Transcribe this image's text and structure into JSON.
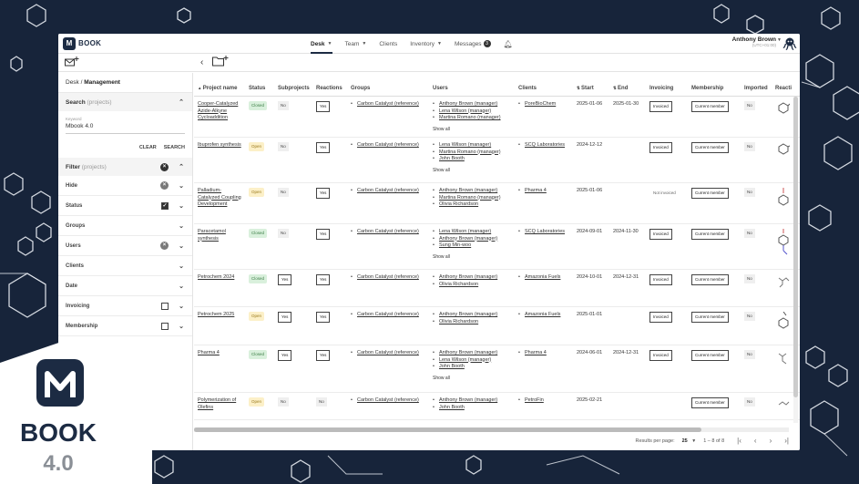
{
  "brand": {
    "name": "BOOK",
    "logo_letter": "M",
    "badge_name": "BOOK",
    "badge_version": "4.0"
  },
  "nav": [
    {
      "label": "Desk",
      "active": true,
      "caret": true
    },
    {
      "label": "Team",
      "caret": true
    },
    {
      "label": "Clients"
    },
    {
      "label": "Inventory",
      "caret": true
    },
    {
      "label": "Messages",
      "badge": "3"
    }
  ],
  "user": {
    "name": "Anthony Brown",
    "sub": "(UTC+01:00)"
  },
  "breadcrumb": {
    "root": "Desk / ",
    "current": "Management"
  },
  "search": {
    "title": "Search",
    "scope": "(projects)",
    "keyword_label": "Keyword",
    "keyword_value": "Mbook 4.0",
    "clear": "CLEAR",
    "submit": "SEARCH"
  },
  "filter": {
    "title": "Filter",
    "scope": "(projects)",
    "rows": [
      {
        "label": "Hide",
        "control": "clear"
      },
      {
        "label": "Status",
        "control": "checkbox-checked"
      },
      {
        "label": "Groups",
        "control": "none"
      },
      {
        "label": "Users",
        "control": "clear"
      },
      {
        "label": "Clients",
        "control": "none"
      },
      {
        "label": "Date",
        "control": "none"
      },
      {
        "label": "Invoicing",
        "control": "checkbox"
      },
      {
        "label": "Membership",
        "control": "checkbox"
      }
    ]
  },
  "table": {
    "columns": [
      "Project name",
      "Status",
      "Subprojects",
      "Reactions",
      "Groups",
      "Users",
      "Clients",
      "Start",
      "End",
      "Invoicing",
      "Membership",
      "Imported",
      "Reacti"
    ],
    "show_all": "Show all",
    "rows": [
      {
        "name": "Cooper-Catalyzed Azide-Alkyne Cycloaddition",
        "status": "Closed",
        "sub": "No",
        "react": "Yes",
        "group": "Carbon Catalyst (reference)",
        "users": [
          "Anthony Brown (manager)",
          "Lena Wilson (manager)",
          "Martina Romano (manager)"
        ],
        "show_all": true,
        "client": "PoreBioChem",
        "start": "2025-01-06",
        "end": "2025-01-30",
        "invoicing": "Invoiced",
        "membership": "Current member",
        "imported": "No"
      },
      {
        "name": "Ibuprofen synthesis",
        "status": "Open",
        "sub": "No",
        "react": "Yes",
        "group": "Carbon Catalyst (reference)",
        "users": [
          "Lena Wilson (manager)",
          "Martina Romano (manager)",
          "John Booth"
        ],
        "show_all": true,
        "client": "SCQ Laboratories",
        "start": "2024-12-12",
        "end": "",
        "invoicing": "Invoiced",
        "membership": "Current member",
        "imported": "No"
      },
      {
        "name": "Palladium-Catalyzed Coupling Development",
        "status": "Open",
        "sub": "No",
        "react": "Yes",
        "group": "Carbon Catalyst (reference)",
        "users": [
          "Anthony Brown (manager)",
          "Martina Romano (manager)",
          "Olivia Richardson"
        ],
        "show_all": false,
        "client": "Pharma 4",
        "start": "2025-01-06",
        "end": "",
        "invoicing": "Not invoiced",
        "membership": "Current member",
        "imported": "No"
      },
      {
        "name": "Paracetamol synthesis",
        "status": "Closed",
        "sub": "No",
        "react": "Yes",
        "group": "Carbon Catalyst (reference)",
        "users": [
          "Lena Wilson (manager)",
          "Anthony Brown (manager)",
          "Sung Min-woo"
        ],
        "show_all": true,
        "client": "SCQ Laboratories",
        "start": "2024-09-01",
        "end": "2024-11-30",
        "invoicing": "Invoiced",
        "membership": "Current member",
        "imported": "No"
      },
      {
        "name": "Petrochem 2024",
        "status": "Closed",
        "sub": "Yes",
        "react": "Yes",
        "group": "Carbon Catalyst (reference)",
        "users": [
          "Anthony Brown (manager)",
          "Olivia Richardson"
        ],
        "show_all": false,
        "client": "Amazonia Fuels",
        "start": "2024-10-01",
        "end": "2024-12-31",
        "invoicing": "Invoiced",
        "membership": "Current member",
        "imported": "No"
      },
      {
        "name": "Petrochem 2025",
        "status": "Open",
        "sub": "Yes",
        "react": "Yes",
        "group": "Carbon Catalyst (reference)",
        "users": [
          "Anthony Brown (manager)",
          "Olivia Richardson"
        ],
        "show_all": false,
        "client": "Amazonia Fuels",
        "start": "2025-01-01",
        "end": "",
        "invoicing": "Invoiced",
        "membership": "Current member",
        "imported": "No"
      },
      {
        "name": "Pharma 4",
        "status": "Closed",
        "sub": "Yes",
        "react": "Yes",
        "group": "Carbon Catalyst (reference)",
        "users": [
          "Anthony Brown (manager)",
          "Lena Wilson (manager)",
          "John Booth"
        ],
        "show_all": true,
        "client": "Pharma 4",
        "start": "2024-06-01",
        "end": "2024-12-31",
        "invoicing": "Invoiced",
        "membership": "Current member",
        "imported": "No"
      },
      {
        "name": "Polymerization of Olefins",
        "status": "Open",
        "sub": "No",
        "react": "No",
        "group": "Carbon Catalyst (reference)",
        "users": [
          "Anthony Brown (manager)",
          "John Booth"
        ],
        "show_all": false,
        "client": "PetroFin",
        "start": "2025-02-21",
        "end": "",
        "invoicing": "",
        "membership": "Current member",
        "imported": "No"
      }
    ]
  },
  "pager": {
    "label": "Results per page:",
    "per_page": "25",
    "range": "1 – 8 of 8"
  },
  "colors": {
    "background": "#17243a",
    "brand": "#1c2b43",
    "closed_bg": "#d9f0dc",
    "open_bg": "#fcf0c8"
  }
}
